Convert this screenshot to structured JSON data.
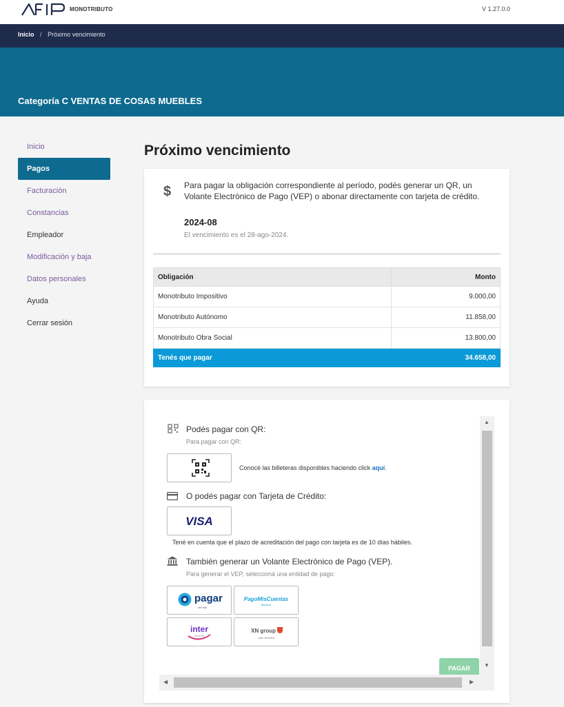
{
  "header": {
    "brand": "MONOTRIBUTO",
    "version": "V 1.27.0.0"
  },
  "breadcrumb": {
    "home": "Inicio",
    "separator": "/",
    "current": "Próximo vencimiento"
  },
  "hero": {
    "title": "Categoría C VENTAS DE COSAS MUEBLES"
  },
  "sidebar": {
    "items": [
      {
        "label": "Inicio"
      },
      {
        "label": "Pagos"
      },
      {
        "label": "Facturación"
      },
      {
        "label": "Constancias"
      },
      {
        "label": "Empleador"
      },
      {
        "label": "Modificación y baja"
      },
      {
        "label": "Datos personales"
      },
      {
        "label": "Ayuda"
      },
      {
        "label": "Cerrar sesión"
      }
    ]
  },
  "main": {
    "title": "Próximo vencimiento",
    "description": "Para pagar la obligación correspondiente al período, podés generar un QR, un Volante Electrónico de Pago (VEP) o abonar directamente con tarjeta de crédito.",
    "period": "2024-08",
    "due_text": "El vencimiento es el 28-ago-2024.",
    "table": {
      "headers": [
        "Obligación",
        "Monto"
      ],
      "rows": [
        {
          "name": "Monotributo Impositivo",
          "amount": "9.000,00"
        },
        {
          "name": "Monotributo Autónomo",
          "amount": "11.858,00"
        },
        {
          "name": "Monotributo Obra Social",
          "amount": "13.800,00"
        }
      ],
      "total": {
        "label": "Tenés que pagar",
        "amount": "34.658,00"
      }
    }
  },
  "payment": {
    "qr": {
      "title": "Podés pagar con QR:",
      "subtitle": "Para pagar con QR:",
      "note_prefix": "Conocé las billeteras disponibles haciendo click",
      "link": "aquí",
      "note_suffix": "."
    },
    "card": {
      "title": "O podés pagar con Tarjeta de Crédito:",
      "visa_label": "VISA",
      "note": "Tené en cuenta que el plazo de acreditación del pago con tarjeta es de 10 días hábiles."
    },
    "vep": {
      "title": "También generar un Volante Electrónico de Pago (VEP).",
      "subtitle": "Para generar el VEP, seleccioná una entidad de pago:",
      "entities": [
        {
          "name": "pagar",
          "small": "red link"
        },
        {
          "name": "PagoMisCuentas",
          "small": "Banelco"
        },
        {
          "name": "inter",
          "small": "banking"
        },
        {
          "name": "XN group",
          "small": "Latin America"
        }
      ]
    },
    "pay_button": "PAGAR"
  }
}
